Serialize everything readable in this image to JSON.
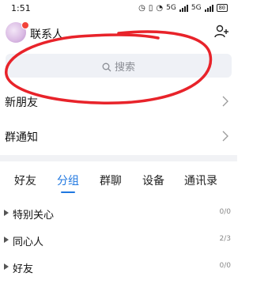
{
  "status_bar": {
    "time": "1:51",
    "signal1": "5G",
    "signal2": "5G",
    "battery": "80"
  },
  "header": {
    "title": "联系人"
  },
  "search": {
    "placeholder": "搜索"
  },
  "rows": [
    {
      "label": "新朋友"
    },
    {
      "label": "群通知"
    }
  ],
  "tabs": [
    {
      "label": "好友",
      "active": false
    },
    {
      "label": "分组",
      "active": true
    },
    {
      "label": "群聊",
      "active": false
    },
    {
      "label": "设备",
      "active": false
    },
    {
      "label": "通讯录",
      "active": false
    }
  ],
  "groups": [
    {
      "name": "特别关心",
      "count": "0/0"
    },
    {
      "name": "同心人",
      "count": "2/3"
    },
    {
      "name": "好友",
      "count": "0/0"
    }
  ],
  "colors": {
    "accent": "#1f77e0",
    "annotation": "#e8232a"
  }
}
